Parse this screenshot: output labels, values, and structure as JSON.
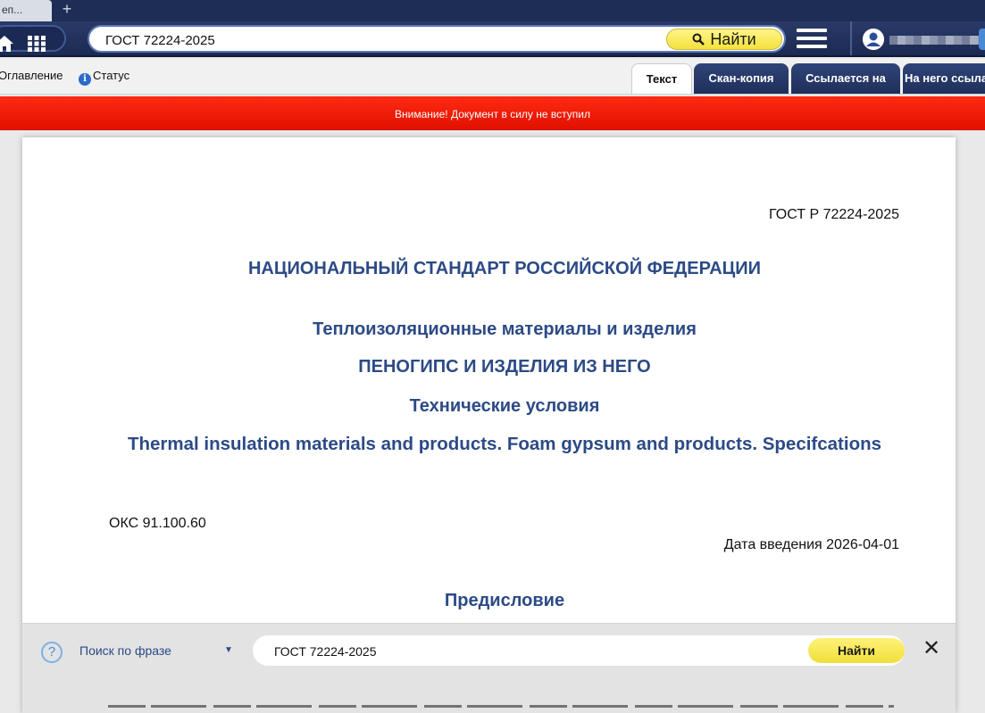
{
  "browser": {
    "tab_title": "еп...",
    "new_tab_symbol": "+"
  },
  "toolbar": {
    "search_value": "ГОСТ 72224-2025",
    "find_label": "Найти"
  },
  "subbar": {
    "toc_label": "Оглавление",
    "status_label": "Статус",
    "tabs": [
      {
        "label": "Текст",
        "active": true
      },
      {
        "label": "Скан-копия",
        "active": false
      },
      {
        "label": "Ссылается на",
        "active": false
      },
      {
        "label": "На него ссылаются",
        "active": false
      }
    ]
  },
  "warning": {
    "text": "Внимание! Документ в силу не вступил"
  },
  "document": {
    "code": "ГОСТ Р 72224-2025",
    "standard_title": "НАЦИОНАЛЬНЫЙ СТАНДАРТ РОССИЙСКОЙ ФЕДЕРАЦИИ",
    "category": "Теплоизоляционные материалы и изделия",
    "name": "ПЕНОГИПС И ИЗДЕЛИЯ ИЗ НЕГО",
    "subtitle": "Технические условия",
    "english_title": "Thermal insulation materials and products. Foam gypsum and products. Specifcations",
    "oks": "ОКС 91.100.60",
    "intro_date": "Дата введения 2026-04-01",
    "foreword": "Предисловие"
  },
  "phrase_search": {
    "help_symbol": "?",
    "mode_label": "Поиск по фразе",
    "caret": "▼",
    "value": "ГОСТ 72224-2025",
    "find_label": "Найти",
    "close_symbol": "✕"
  },
  "colors": {
    "toolbar": "#1e2d55",
    "heading": "#2c4a86",
    "warning": "#ff2a12",
    "find_button": "#f4e23c"
  }
}
